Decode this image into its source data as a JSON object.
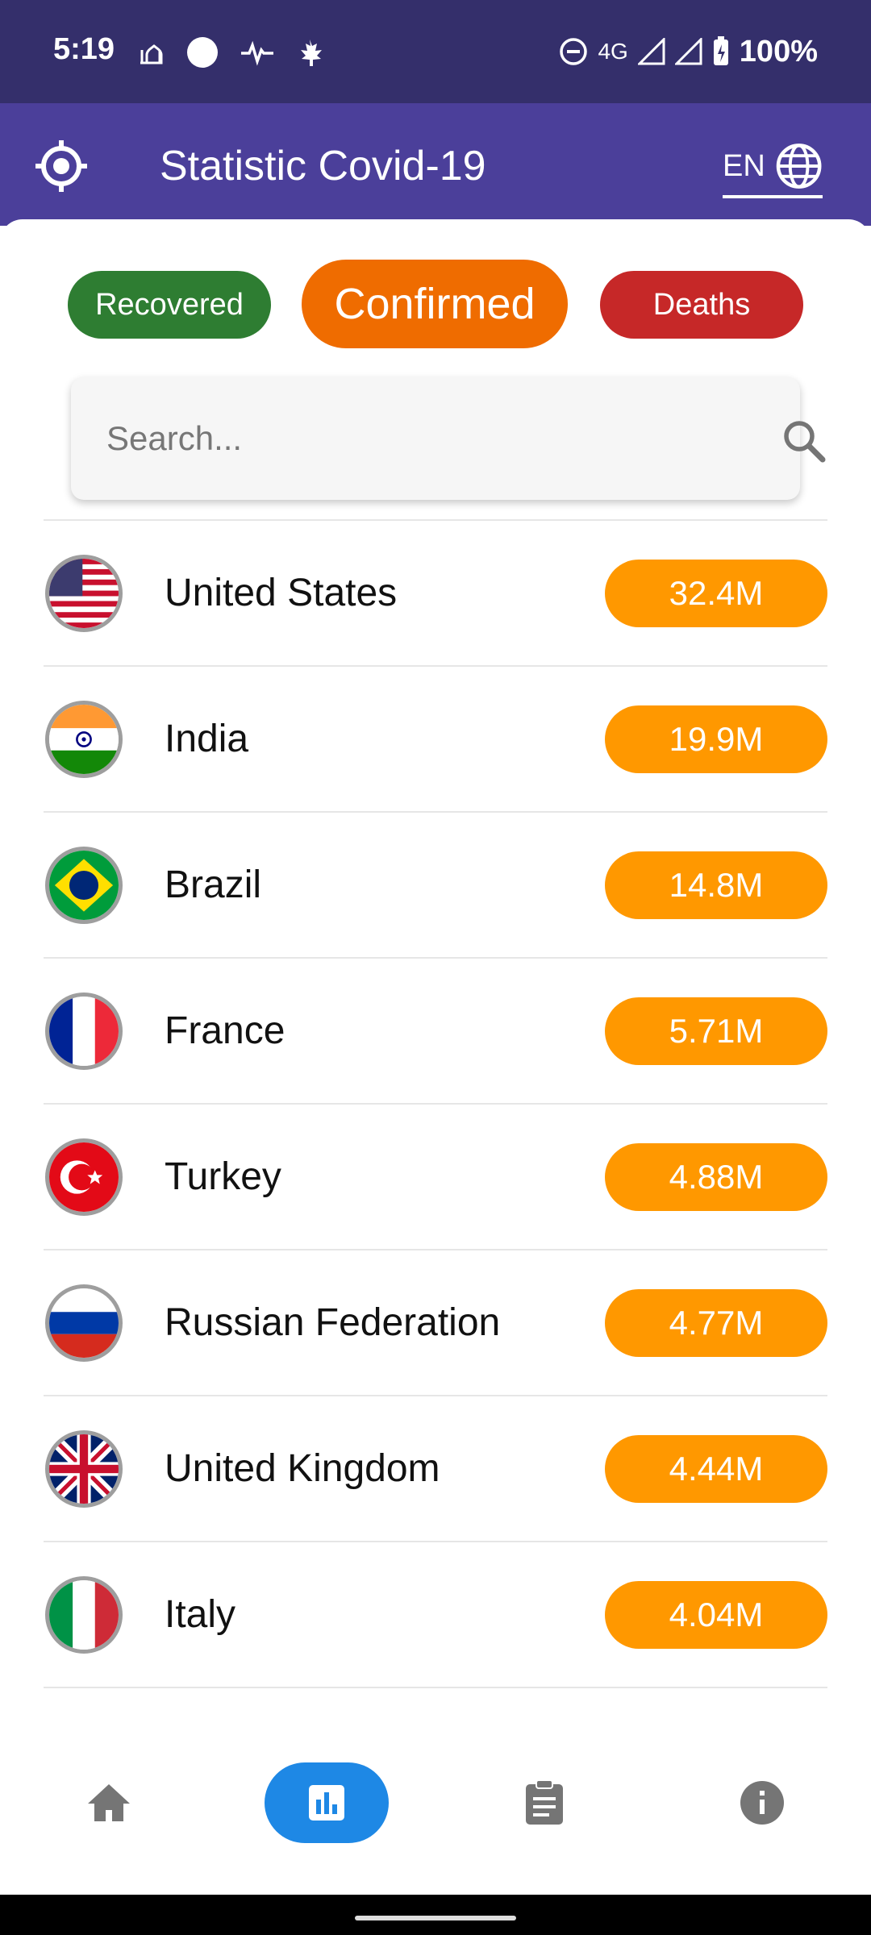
{
  "status_bar": {
    "time": "5:19",
    "network": "4G",
    "battery": "100%"
  },
  "app_bar": {
    "title": "Statistic Covid-19",
    "language": "EN"
  },
  "filters": {
    "recovered": "Recovered",
    "confirmed": "Confirmed",
    "deaths": "Deaths",
    "active": "Confirmed"
  },
  "search": {
    "placeholder": "Search..."
  },
  "countries": [
    {
      "name": "United States",
      "value": "32.4M",
      "flag": "us-flag"
    },
    {
      "name": "India",
      "value": "19.9M",
      "flag": "india-flag"
    },
    {
      "name": "Brazil",
      "value": "14.8M",
      "flag": "brazil-flag"
    },
    {
      "name": "France",
      "value": "5.71M",
      "flag": "france-flag"
    },
    {
      "name": "Turkey",
      "value": "4.88M",
      "flag": "turkey-flag"
    },
    {
      "name": "Russian Federation",
      "value": "4.77M",
      "flag": "russia-flag"
    },
    {
      "name": "United Kingdom",
      "value": "4.44M",
      "flag": "uk-flag"
    },
    {
      "name": "Italy",
      "value": "4.04M",
      "flag": "italy-flag"
    }
  ],
  "bottom_nav": {
    "items": [
      "home-icon",
      "bar-chart-icon",
      "clipboard-icon",
      "info-icon"
    ],
    "active": "bar-chart-icon"
  },
  "colors": {
    "status_bar": "#342f6b",
    "app_bar": "#4b3f9a",
    "recovered": "#2e7d32",
    "confirmed": "#ef6c00",
    "deaths": "#c62828",
    "badge": "#ff9800",
    "nav_active": "#1e88e5"
  }
}
